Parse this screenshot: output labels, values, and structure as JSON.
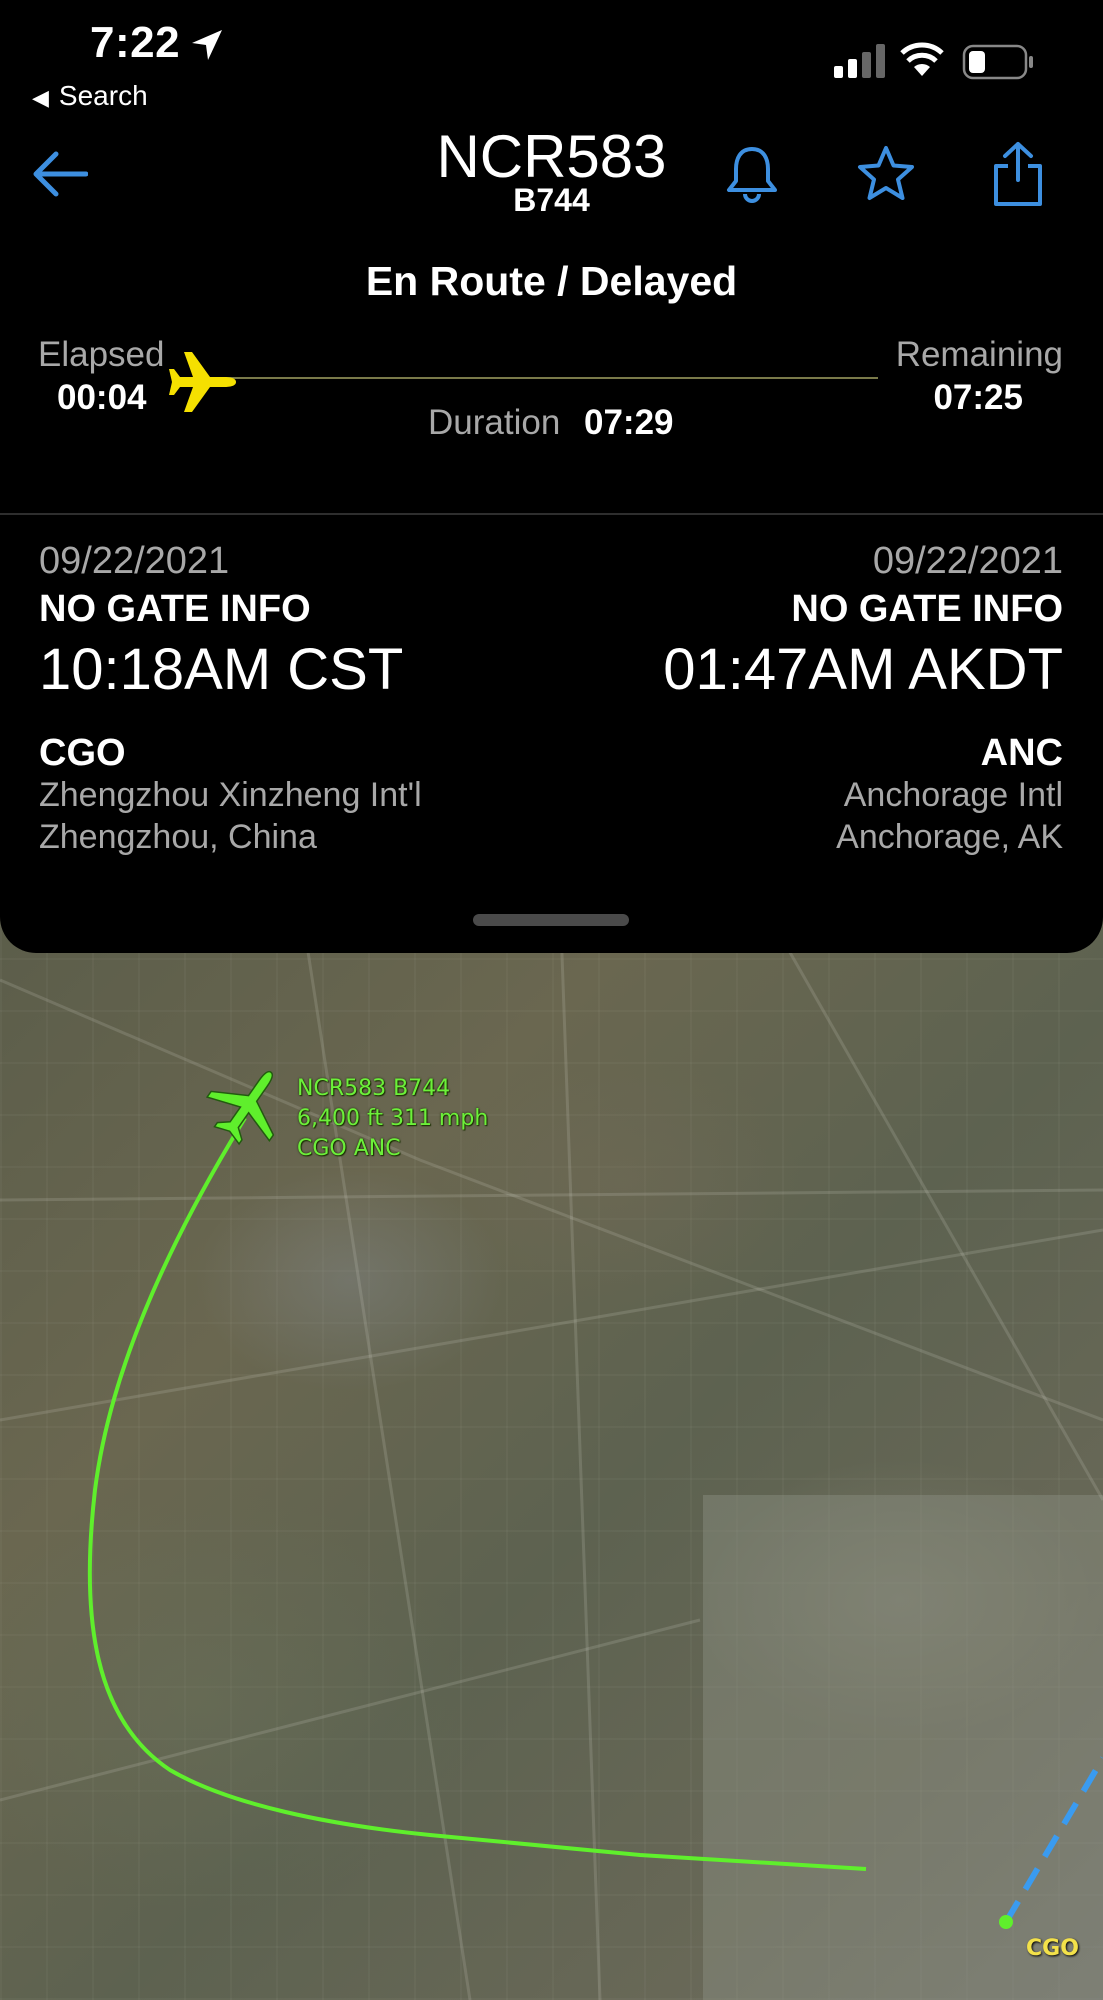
{
  "status_bar": {
    "time": "7:22",
    "back_app": "Search",
    "icons": [
      "location-arrow-icon",
      "signal-icon",
      "wifi-icon",
      "battery-icon"
    ]
  },
  "header": {
    "flight_number": "NCR583",
    "aircraft": "B744",
    "icons": [
      "back-arrow-icon",
      "bell-icon",
      "star-icon",
      "share-icon"
    ],
    "accent_color": "#3d8fe0"
  },
  "flight_status": "En Route / Delayed",
  "progress": {
    "elapsed_label": "Elapsed",
    "elapsed": "00:04",
    "remaining_label": "Remaining",
    "remaining": "07:25",
    "duration_label": "Duration",
    "duration": "07:29",
    "progress_fraction": 0.01,
    "plane_color": "#f5e000"
  },
  "origin": {
    "date": "09/22/2021",
    "gate": "NO GATE INFO",
    "time": "10:18AM CST",
    "code": "CGO",
    "airport": "Zhengzhou Xinzheng Int'l",
    "city": "Zhengzhou, China"
  },
  "destination": {
    "date": "09/22/2021",
    "gate": "NO GATE INFO",
    "time": "01:47AM AKDT",
    "code": "ANC",
    "airport": "Anchorage Intl",
    "city": "Anchorage, AK"
  },
  "map": {
    "aircraft_label_line1": "NCR583 B744",
    "aircraft_label_line2": "6,400 ft 311 mph",
    "aircraft_label_line3": "CGO ANC",
    "airport_label": "CGO",
    "track_color": "#5fef2c",
    "planned_route_color": "#3a9bf0"
  }
}
